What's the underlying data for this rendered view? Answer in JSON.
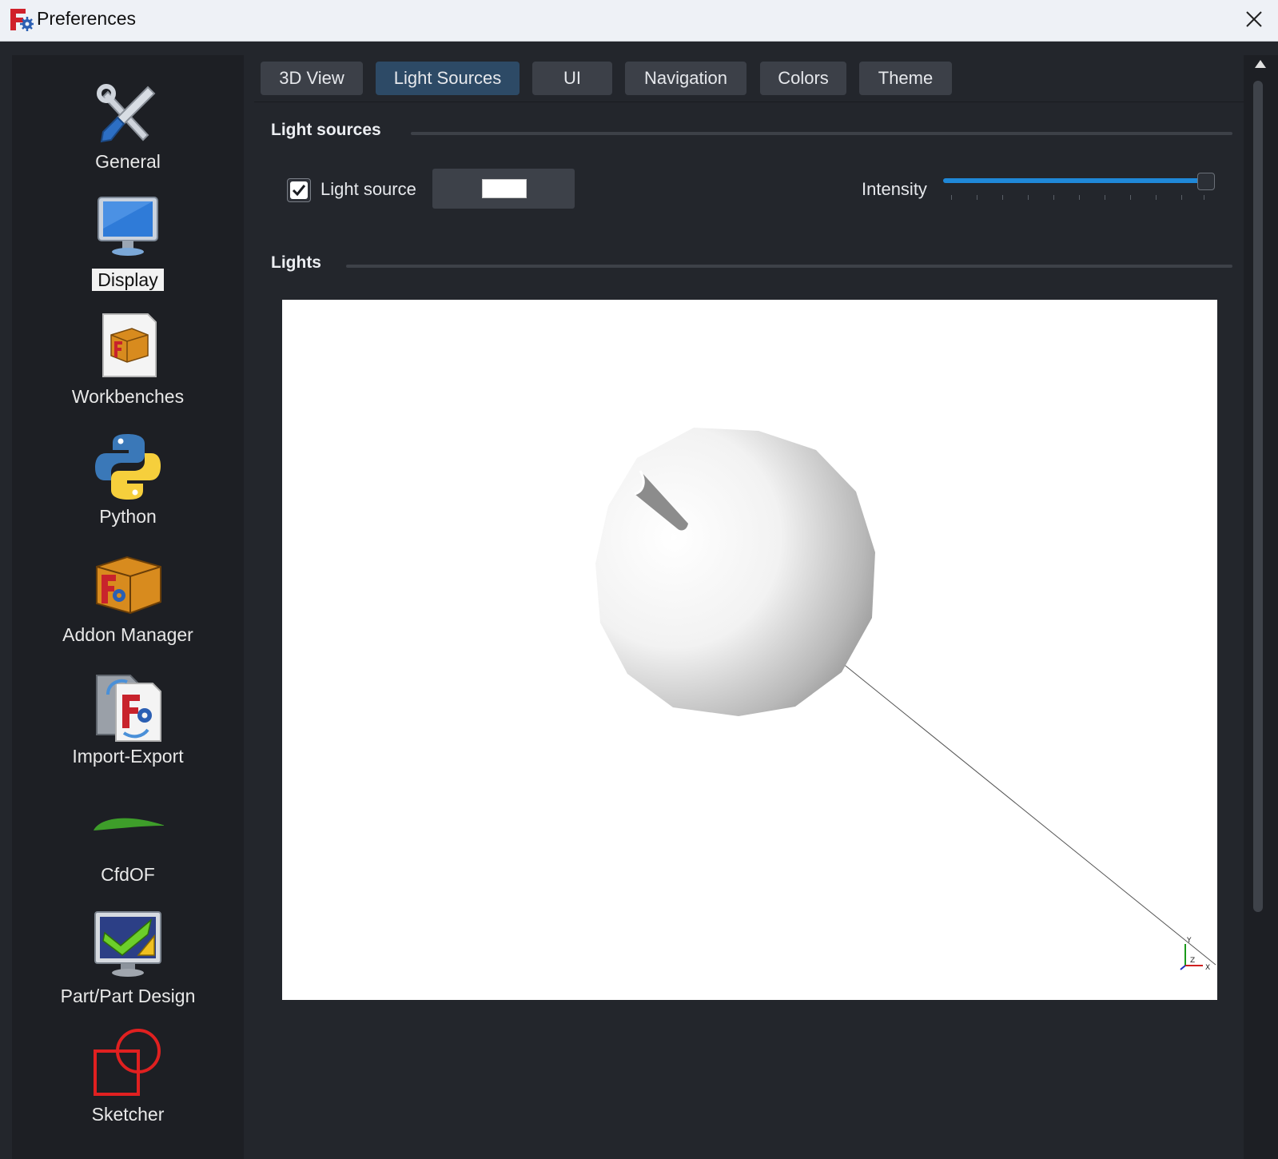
{
  "window": {
    "title": "Preferences",
    "icons": {
      "app": "freecad-logo-icon",
      "close": "close-icon"
    }
  },
  "sidebar": {
    "items": [
      {
        "label": "General",
        "icon": "wrench-screwdriver-icon",
        "selected": false
      },
      {
        "label": "Display",
        "icon": "monitor-icon",
        "selected": true
      },
      {
        "label": "Workbenches",
        "icon": "workbench-package-icon",
        "selected": false
      },
      {
        "label": "Python",
        "icon": "python-logo-icon",
        "selected": false
      },
      {
        "label": "Addon Manager",
        "icon": "addon-box-icon",
        "selected": false
      },
      {
        "label": "Import-Export",
        "icon": "import-export-icon",
        "selected": false
      },
      {
        "label": "CfdOF",
        "icon": "airfoil-icon",
        "selected": false
      },
      {
        "label": "Part/Part Design",
        "icon": "part-design-icon",
        "selected": false
      },
      {
        "label": "Sketcher",
        "icon": "sketcher-icon",
        "selected": false
      }
    ]
  },
  "tabs": [
    {
      "label": "3D View",
      "active": false
    },
    {
      "label": "Light Sources",
      "active": true
    },
    {
      "label": "UI",
      "active": false
    },
    {
      "label": "Navigation",
      "active": false
    },
    {
      "label": "Colors",
      "active": false
    },
    {
      "label": "Theme",
      "active": false
    }
  ],
  "light_sources": {
    "section_title": "Light sources",
    "checkbox_label": "Light source",
    "checked": true,
    "color": "#ffffff",
    "intensity_label": "Intensity",
    "intensity_fraction": 1.0
  },
  "lights": {
    "section_title": "Lights",
    "axis_labels": {
      "x": "X",
      "y": "Y",
      "z": "Z"
    }
  },
  "colors": {
    "accent": "#1f88d8",
    "active_tab": "#2d4a66",
    "background": "#23262c"
  }
}
